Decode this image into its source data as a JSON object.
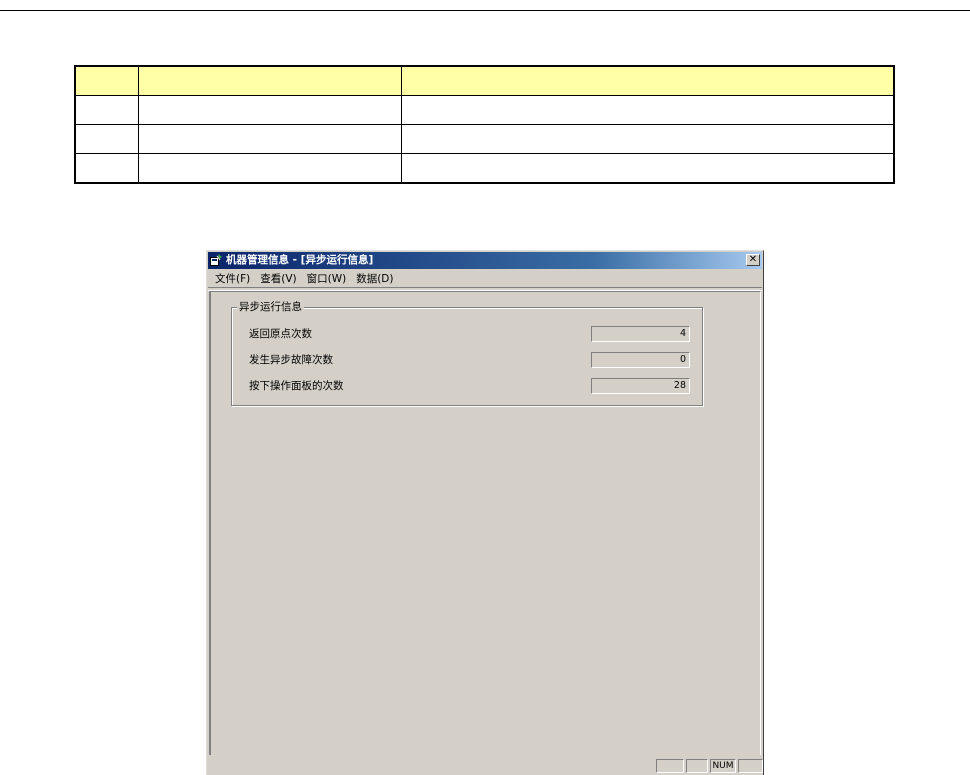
{
  "window": {
    "title": "机器管理信息 - [异步运行信息]",
    "close_glyph": "✕"
  },
  "menu": [
    {
      "label": "文件(F)"
    },
    {
      "label": "查看(V)"
    },
    {
      "label": "窗口(W)"
    },
    {
      "label": "数据(D)"
    }
  ],
  "group": {
    "title": "异步运行信息",
    "fields": [
      {
        "label": "返回原点次数",
        "value": "4"
      },
      {
        "label": "发生异步故障次数",
        "value": "0"
      },
      {
        "label": "按下操作面板的次数",
        "value": "28"
      }
    ]
  },
  "statusbar": {
    "num": "NUM"
  },
  "colors": {
    "table_header": "#ffffa8",
    "window_face": "#d4d0c8",
    "titlebar_start": "#0a246a",
    "titlebar_end": "#a6caf0"
  },
  "icons": {
    "app": "app-icon",
    "close": "close-icon"
  }
}
